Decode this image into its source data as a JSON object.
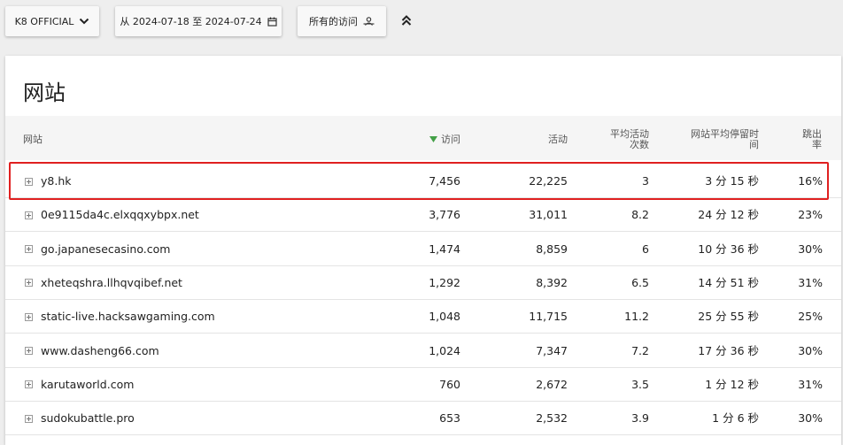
{
  "toolbar": {
    "site_selector": "K8 OFFICIAL",
    "date_range": "从 2024-07-18 至 2024-07-24",
    "segment": "所有的访问"
  },
  "card": {
    "title": "网站"
  },
  "table": {
    "headers": {
      "site": "网站",
      "visits": "访问",
      "actions": "活动",
      "avg_actions_line1": "平均活动",
      "avg_actions_line2": "次数",
      "avg_time_line1": "网站平均停留时",
      "avg_time_line2": "间",
      "bounce_line1": "跳出",
      "bounce_line2": "率"
    },
    "sort_indicator_color": "#43a047",
    "rows": [
      {
        "site": "y8.hk",
        "visits": "7,456",
        "actions": "22,225",
        "avg_actions": "3",
        "avg_time": "3 分 15 秒",
        "bounce": "16%"
      },
      {
        "site": "0e9115da4c.elxqqxybpx.net",
        "visits": "3,776",
        "actions": "31,011",
        "avg_actions": "8.2",
        "avg_time": "24 分 12 秒",
        "bounce": "23%"
      },
      {
        "site": "go.japanesecasino.com",
        "visits": "1,474",
        "actions": "8,859",
        "avg_actions": "6",
        "avg_time": "10 分 36 秒",
        "bounce": "30%"
      },
      {
        "site": "xheteqshra.llhqvqibef.net",
        "visits": "1,292",
        "actions": "8,392",
        "avg_actions": "6.5",
        "avg_time": "14 分 51 秒",
        "bounce": "31%"
      },
      {
        "site": "static-live.hacksawgaming.com",
        "visits": "1,048",
        "actions": "11,715",
        "avg_actions": "11.2",
        "avg_time": "25 分 55 秒",
        "bounce": "25%"
      },
      {
        "site": "www.dasheng66.com",
        "visits": "1,024",
        "actions": "7,347",
        "avg_actions": "7.2",
        "avg_time": "17 分 36 秒",
        "bounce": "30%"
      },
      {
        "site": "karutaworld.com",
        "visits": "760",
        "actions": "2,672",
        "avg_actions": "3.5",
        "avg_time": "1 分 12 秒",
        "bounce": "31%"
      },
      {
        "site": "sudokubattle.pro",
        "visits": "653",
        "actions": "2,532",
        "avg_actions": "3.9",
        "avg_time": "1 分 6 秒",
        "bounce": "30%"
      }
    ]
  },
  "highlight_color": "#e02020"
}
